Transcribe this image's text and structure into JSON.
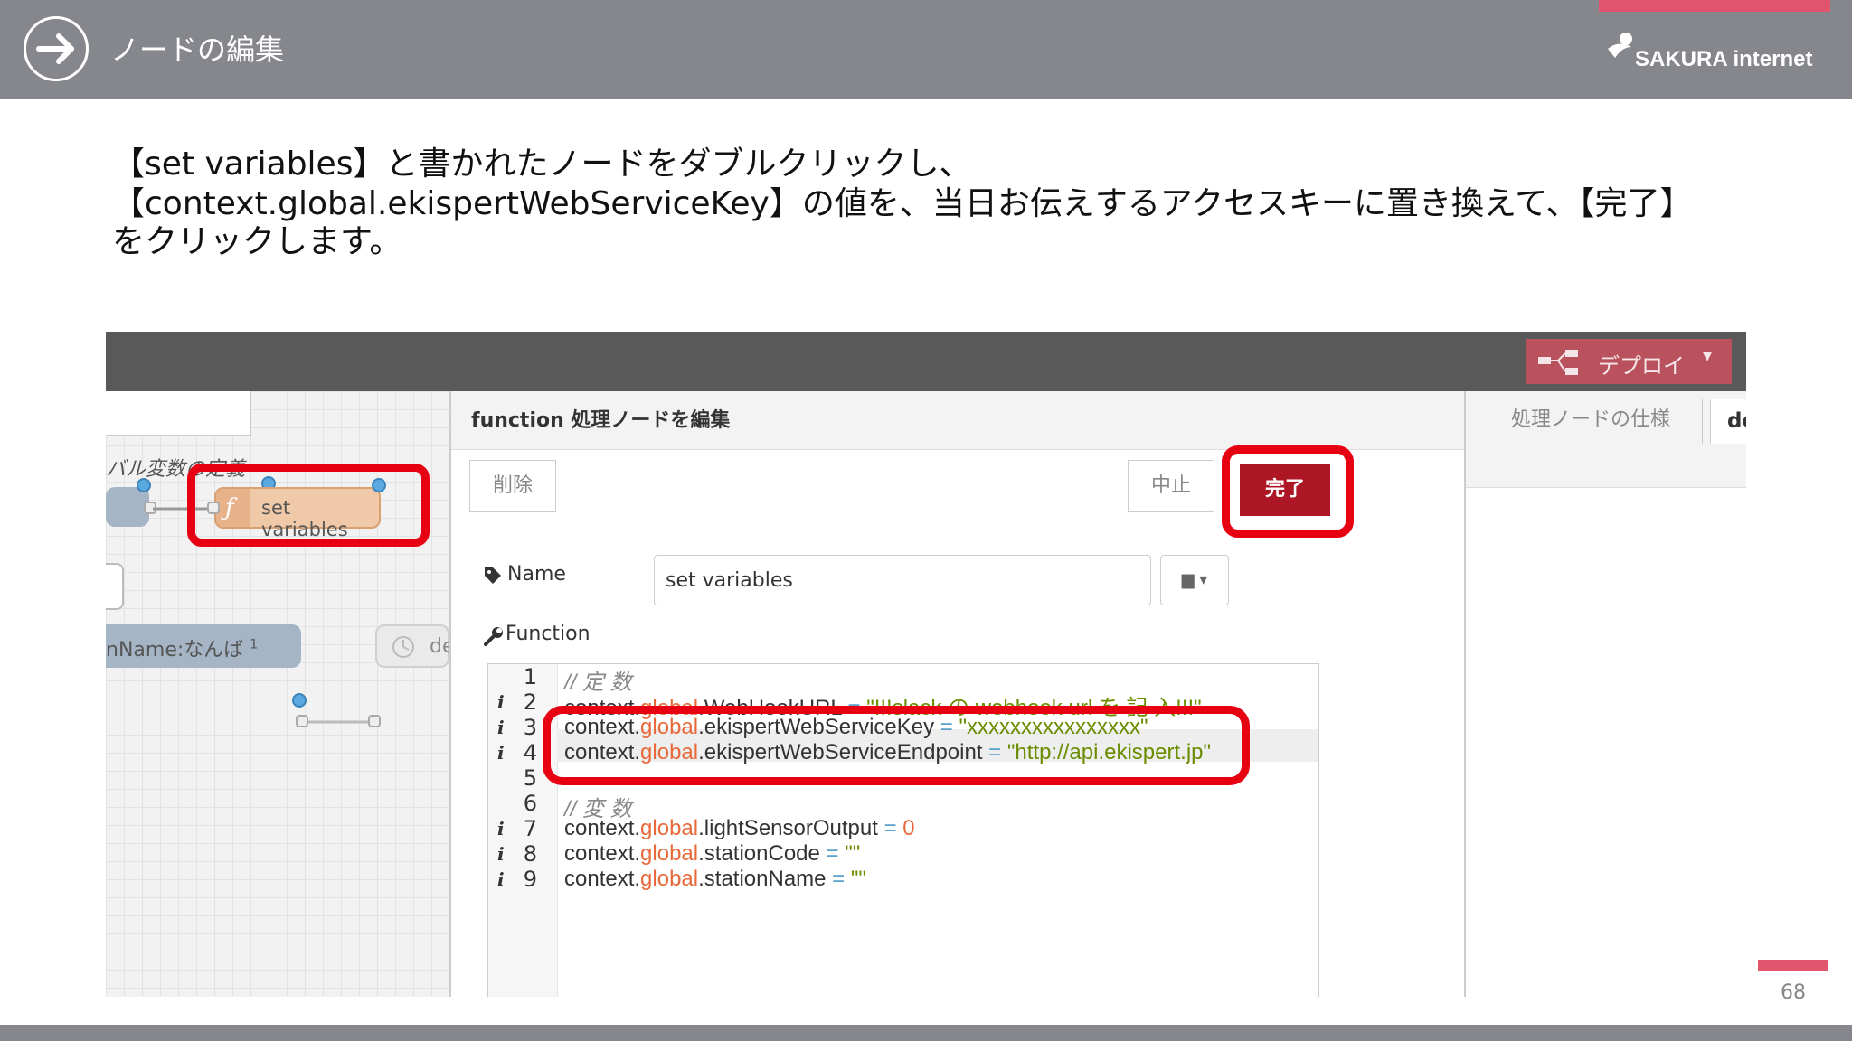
{
  "slide": {
    "title": "ノードの編集",
    "brand": "SAKURA internet",
    "page_number": "68",
    "instructions": [
      "【set variables】と書かれたノードをダブルクリックし、",
      "【context.global.ekispertWebServiceKey】の値を、当日お伝えするアクセスキーに置き換えて、【完了】",
      "をクリックします。"
    ]
  },
  "app": {
    "deploy_label": "デプロイ",
    "flow": {
      "group_label": "バル変数の定義",
      "set_node_label": "set variables",
      "name_node_label": "nName:なんば",
      "name_node_badge": "1",
      "delay_node_label": "de"
    },
    "dialog": {
      "title": "function 処理ノードを編集",
      "delete_label": "削除",
      "cancel_label": "中止",
      "done_label": "完了",
      "name_label": "Name",
      "name_value": "set variables",
      "function_label": "Function",
      "code_lines": [
        {
          "n": "1",
          "info": ""
        },
        {
          "n": "2",
          "info": "i"
        },
        {
          "n": "3",
          "info": "i"
        },
        {
          "n": "4",
          "info": "i"
        },
        {
          "n": "5",
          "info": ""
        },
        {
          "n": "6",
          "info": ""
        },
        {
          "n": "7",
          "info": "i"
        },
        {
          "n": "8",
          "info": "i"
        },
        {
          "n": "9",
          "info": "i"
        }
      ],
      "code": {
        "l1": "// 定 数",
        "l2_ctx": "context.",
        "l2_glob": "global",
        "l2_rest": ".WebHookURL",
        "l2_op": " = ",
        "l2_str": "\"!!!slack の webhook url を 記 入!!!\"",
        "l3_ctx": "context.",
        "l3_glob": "global",
        "l3_rest": ".ekispertWebServiceKey",
        "l3_op": " = ",
        "l3_str": "\"xxxxxxxxxxxxxxxx\"",
        "l4_ctx": "context.",
        "l4_glob": "global",
        "l4_rest": ".ekispertWebServiceEndpoint",
        "l4_op": " = ",
        "l4_str": "\"http://api.ekispert.jp\"",
        "l6": "// 変 数",
        "l7_ctx": "context.",
        "l7_glob": "global",
        "l7_rest": ".lightSensorOutput",
        "l7_op": " = ",
        "l7_num": "0",
        "l8_ctx": "context.",
        "l8_glob": "global",
        "l8_rest": ".stationCode",
        "l8_op": " = ",
        "l8_str": "\"\"",
        "l9_ctx": "context.",
        "l9_glob": "global",
        "l9_rest": ".stationName",
        "l9_op": " = ",
        "l9_str": "\"\""
      }
    },
    "sidebar": {
      "tab_info": "処理ノードの仕様",
      "tab_debug": "debug"
    }
  },
  "colors": {
    "header_gray": "#85878c",
    "accent_pink": "#e0556c",
    "highlight_red": "#e60012",
    "done_button": "#ad1625",
    "deploy_button": "#b9525d"
  }
}
